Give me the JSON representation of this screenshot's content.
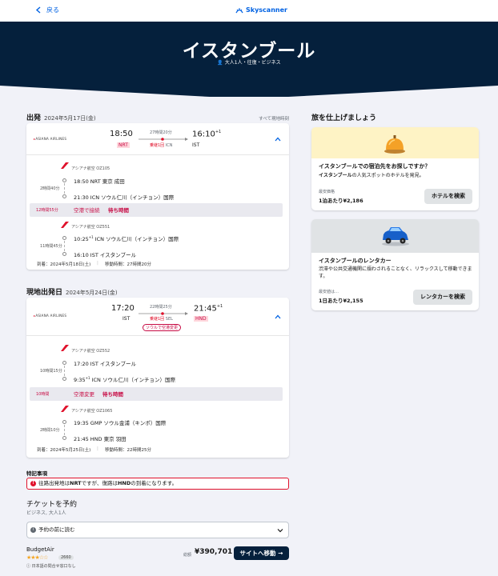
{
  "topbar": {
    "back_label": "戻る",
    "logo_text": "Skyscanner"
  },
  "hero": {
    "title": "イスタンブール",
    "subtitle": "大人1人・往復・ビジネス"
  },
  "outbound": {
    "heading": "出発",
    "date": "2024年5月17日(金)",
    "tz_note": "すべて現地時刻",
    "airline_logo": "ASIANA AIRLINES",
    "dep_time": "18:50",
    "dep_code": "NRT",
    "arr_time": "16:10",
    "arr_sup": "+1",
    "arr_code": "IST",
    "duration": "27時間20分",
    "stops": "乗継1回",
    "stop_code": "ICN",
    "seg1": {
      "airline": "アシアナ航空 OZ105",
      "duration": "2時間40分",
      "dep": "18:50  NRT 東京 成田",
      "arr": "21:30  ICN ソウル仁川（インチョン）国際"
    },
    "layover": {
      "time": "12時間55分",
      "airport_change": "空港で接続",
      "wait": "待ち時間"
    },
    "seg2": {
      "airline": "アシアナ航空 OZ551",
      "duration": "11時間45分",
      "dep_time": "10:25",
      "dep_sup": "+1",
      "dep": " ICN ソウル仁川（インチョン）国際",
      "arr": "16:10   IST イスタンブール"
    },
    "foot_arrival": "到着：2024年5月18日(土)",
    "foot_total": "移動時間：27時間20分"
  },
  "inbound": {
    "heading": "現地出発日",
    "date": "2024年5月24日(金)",
    "airline_logo": "ASIANA AIRLINES",
    "dep_time": "17:20",
    "dep_code": "IST",
    "arr_time": "21:45",
    "arr_sup": "+1",
    "arr_code": "HND",
    "duration": "22時間25分",
    "stops": "乗継1回",
    "stop_code": "SEL",
    "airport_change_tag": "ソウルで空港変更",
    "seg1": {
      "airline": "アシアナ航空 OZ552",
      "duration": "10時間15分",
      "dep": "17:20  IST イスタンブール",
      "arr_time": "9:35",
      "arr_sup": "+1",
      "arr": " ICN ソウル仁川（インチョン）国際"
    },
    "layover": {
      "time": "10時間",
      "airport_change": "空港変更",
      "wait": "待ち時間"
    },
    "seg2": {
      "airline": "アシアナ航空 OZ1065",
      "duration": "2時間10分",
      "dep": "19:35  GMP ソウル金浦（キンポ）国際",
      "arr": "21:45  HND 東京 羽田"
    },
    "foot_arrival": "到着：2024年5月25日(土)",
    "foot_total": "移動時間：22時間25分"
  },
  "notes": {
    "heading": "特記事項",
    "alert_pre": "往路出発地は",
    "alert_a": "NRT",
    "alert_mid": "ですが、復路は",
    "alert_b": "HND",
    "alert_post": "の到着になります。"
  },
  "booking": {
    "heading": "チケットを予約",
    "sub": "ビジネス, 大人1人",
    "read_before": "予約の前に読む",
    "provider": "BudgetAir",
    "stars": "★★★☆☆",
    "review_count": "2660",
    "provider_note": "日本語の問合せ窓口なし",
    "price_label": "総額",
    "price": "¥390,701",
    "cta": "サイトへ移動 →"
  },
  "sidebar": {
    "heading": "旅を仕上げましょう",
    "hotel": {
      "title": "イスタンブールでの宿泊先をお探しですか？",
      "desc_bold": "イスタンブール",
      "desc_rest": "の人気スポットのホテルを発見。",
      "price_caption": "最安価格",
      "price": "1泊あたり¥2,186",
      "button": "ホテルを検索"
    },
    "car": {
      "title": "イスタンブールのレンタカー",
      "desc": "渋滞や公共交通機関に煩わされることなく、リラックスして移動できます。",
      "price_caption": "最安値は…",
      "price": "1日あたり¥2,155",
      "button": "レンタカーを検索"
    }
  },
  "colors": {
    "navy": "#05203c",
    "blue": "#0062e3",
    "red": "#e0112b",
    "pink": "#c70b44",
    "hotel_bg": "#fef3c5",
    "car_bg": "#e0e3e5"
  }
}
